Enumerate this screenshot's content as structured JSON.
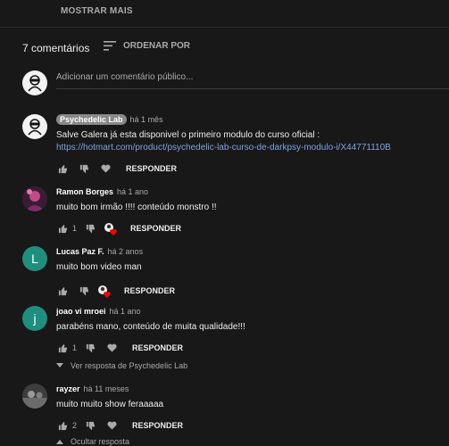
{
  "header": {
    "show_more": "MOSTRAR MAIS",
    "comment_count": "7 comentários",
    "sort_label": "ORDENAR POR"
  },
  "add_comment": {
    "placeholder": "Adicionar um comentário público..."
  },
  "comments": [
    {
      "author": "Psychedelic Lab",
      "time": "há 1 mês",
      "text": "Salve Galera já esta disponivel o primeiro modulo do curso oficial :",
      "link": "https://hotmart.com/product/psychedelic-lab-curso-de-darkpsy-modulo-i/X44771110B",
      "likes": "",
      "reply_label": "RESPONDER"
    },
    {
      "author": "Ramon Borges",
      "time": "há 1 ano",
      "text": "muito bom irmão !!!! conteúdo monstro !!",
      "likes": "1",
      "reply_label": "RESPONDER"
    },
    {
      "author": "Lucas Paz F.",
      "time": "há 2 anos",
      "text": "muito bom video man",
      "avatar_letter": "L",
      "likes": "",
      "reply_label": "RESPONDER"
    },
    {
      "author": "joao vi mroei",
      "time": "há 1 ano",
      "text": "parabéns mano, conteúdo de muita  qualidade!!!",
      "avatar_letter": "j",
      "likes": "1",
      "reply_label": "RESPONDER",
      "replies_link": "Ver resposta de Psychedelic Lab"
    },
    {
      "author": "rayzer",
      "time": "há 11 meses",
      "text": "muito muito show feraaaaa",
      "likes": "2",
      "reply_label": "RESPONDER",
      "replies_link": "Ocultar resposta"
    }
  ],
  "colors": {
    "background": "#181818",
    "link": "#7ba4e0",
    "avatar_lucas": "#1e8f7e",
    "avatar_joao": "#1e8f7e",
    "heart": "#ff0000"
  }
}
